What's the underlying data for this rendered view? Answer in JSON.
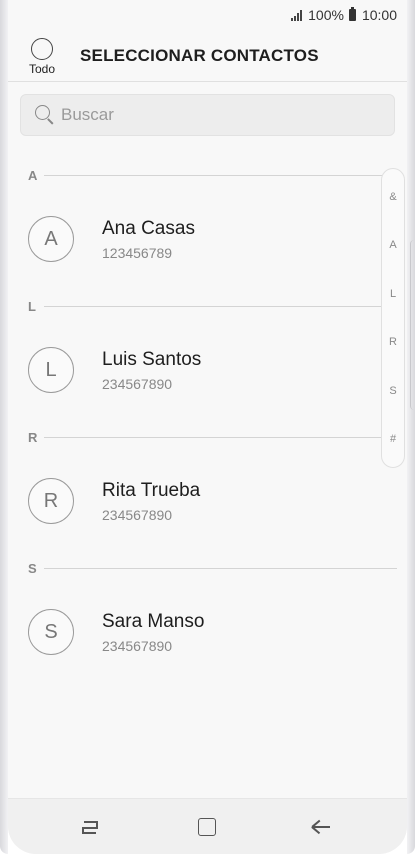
{
  "status_bar": {
    "battery": "100%",
    "time": "10:00"
  },
  "header": {
    "select_all_label": "Todo",
    "title": "SELECCIONAR CONTACTOS"
  },
  "search": {
    "placeholder": "Buscar"
  },
  "sections": [
    {
      "letter": "A",
      "contact": {
        "initial": "A",
        "name": "Ana Casas",
        "number": "123456789"
      }
    },
    {
      "letter": "L",
      "contact": {
        "initial": "L",
        "name": "Luis Santos",
        "number": "234567890"
      }
    },
    {
      "letter": "R",
      "contact": {
        "initial": "R",
        "name": "Rita Trueba",
        "number": "234567890"
      }
    },
    {
      "letter": "S",
      "contact": {
        "initial": "S",
        "name": "Sara Manso",
        "number": "234567890"
      }
    }
  ],
  "index_bar": [
    "&",
    "A",
    "L",
    "R",
    "S",
    "#"
  ],
  "nav_bar": {
    "icons": [
      "recents-icon",
      "home-icon",
      "back-icon"
    ]
  }
}
